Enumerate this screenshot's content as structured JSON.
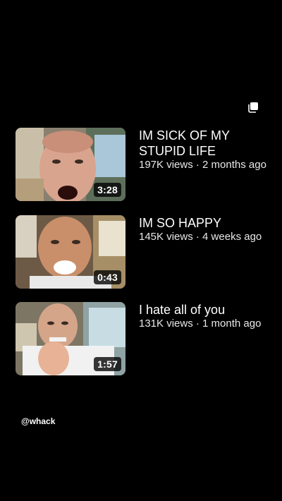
{
  "header": {
    "icon": "collection-stack-icon"
  },
  "videos": [
    {
      "title": "IM SICK OF MY STUPID LIFE",
      "title_line1": "IM SICK OF MY",
      "title_line2": "STUPID LIFE",
      "meta": "197K views · 2 months ago",
      "duration": "3:28"
    },
    {
      "title": "IM SO HAPPY",
      "meta": "145K views · 4 weeks ago",
      "duration": "0:43"
    },
    {
      "title": "I hate all of you",
      "meta": "131K views · 1 month ago",
      "duration": "1:57"
    }
  ],
  "footer": {
    "handle": "@whack"
  }
}
